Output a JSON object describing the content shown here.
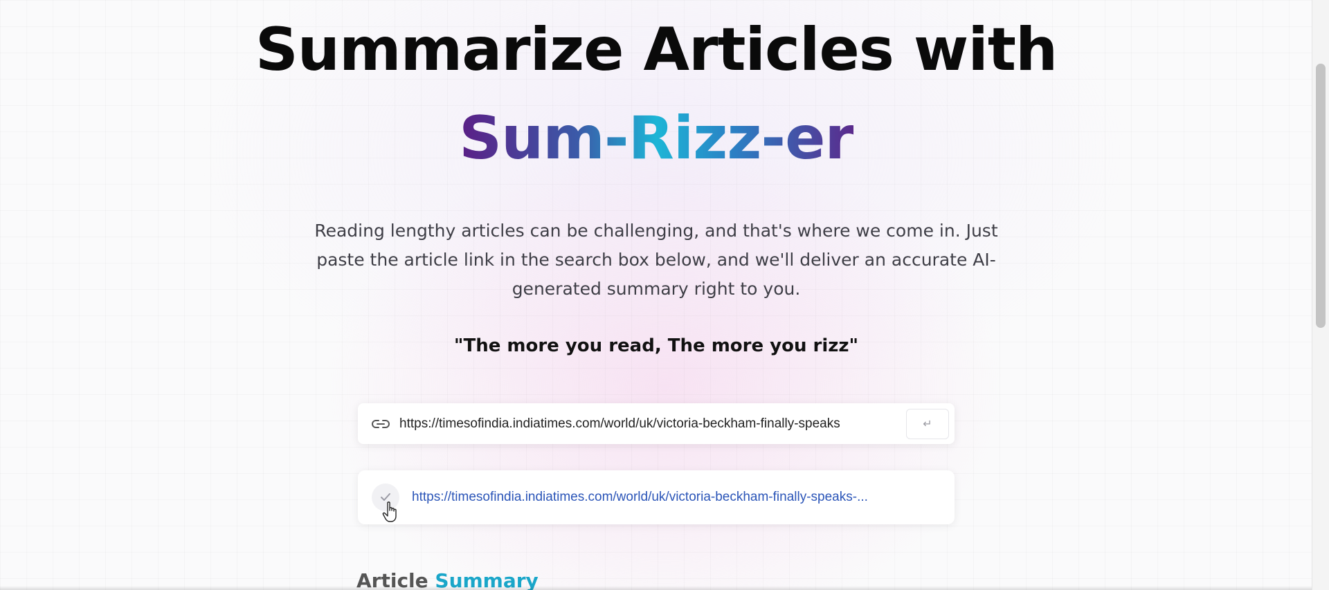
{
  "hero": {
    "headline": "Summarize Articles with",
    "brand": "Sum-Rizz-er",
    "description": "Reading lengthy articles can be challenging, and that's where we come in. Just paste the article link in the search box below, and we'll deliver an accurate AI-generated summary right to you.",
    "quote": "\"The more you read, The more you rizz\""
  },
  "search": {
    "value": "https://timesofindia.indiatimes.com/world/uk/victoria-beckham-finally-speaks",
    "submit_label": "↵",
    "icon": "link-icon"
  },
  "history": {
    "items": [
      {
        "url": "https://timesofindia.indiatimes.com/world/uk/victoria-beckham-finally-speaks-...",
        "icon": "copy-icon"
      }
    ]
  },
  "summary": {
    "heading_prefix": "Article",
    "heading_accent": "Summary"
  },
  "colors": {
    "brand_gradient_start": "#5b1f86",
    "brand_gradient_mid": "#1db5d6",
    "link": "#2b55b8",
    "accent": "#1aa6c9"
  }
}
